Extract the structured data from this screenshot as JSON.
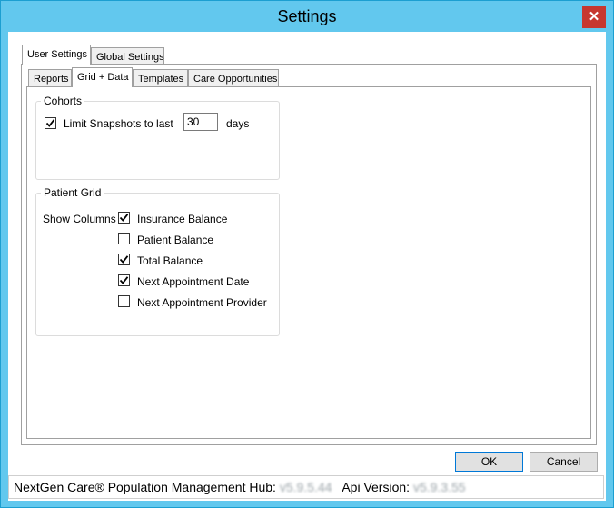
{
  "window": {
    "title": "Settings"
  },
  "outer_tabs": [
    {
      "label": "User Settings"
    },
    {
      "label": "Global Settings"
    }
  ],
  "inner_tabs": [
    {
      "label": "Reports"
    },
    {
      "label": "Grid + Data"
    },
    {
      "label": "Templates"
    },
    {
      "label": "Care Opportunities"
    }
  ],
  "cohorts": {
    "title": "Cohorts",
    "limit_label": "Limit Snapshots to last",
    "limit_checked": true,
    "days_value": "30",
    "days_label": "days"
  },
  "patient_grid": {
    "title": "Patient Grid",
    "show_columns_label": "Show Columns",
    "columns": [
      {
        "label": "Insurance Balance",
        "checked": true
      },
      {
        "label": "Patient Balance",
        "checked": false
      },
      {
        "label": "Total Balance",
        "checked": true
      },
      {
        "label": "Next Appointment Date",
        "checked": true
      },
      {
        "label": "Next Appointment Provider",
        "checked": false
      }
    ]
  },
  "buttons": {
    "ok": "OK",
    "cancel": "Cancel"
  },
  "status": {
    "hub_label": "NextGen Care® Population Management Hub:",
    "hub_version": "v5.9.5.44",
    "api_label": "Api Version:",
    "api_version": "v5.9.3.55"
  },
  "colors": {
    "titlebar": "#62c8ee",
    "close": "#c7372f",
    "default_button_border": "#0078d7"
  }
}
